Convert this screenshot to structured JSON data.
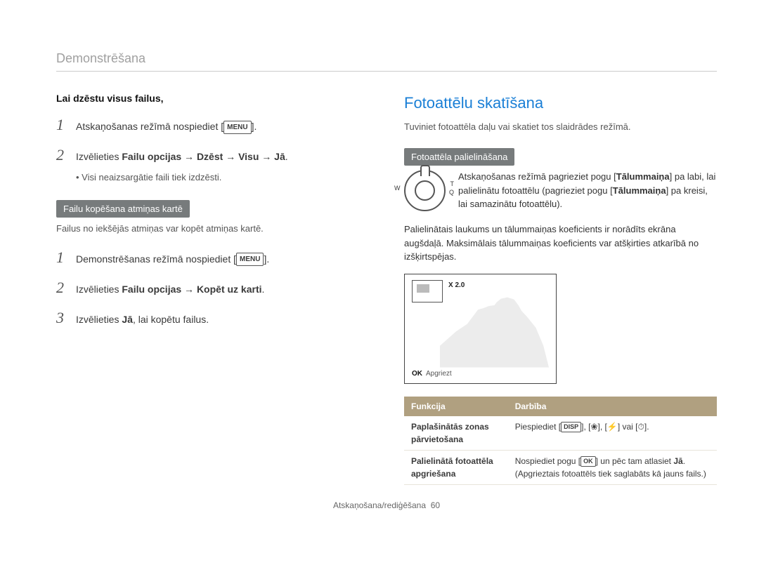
{
  "header": "Demonstrēšana",
  "left": {
    "subhead_delete": "Lai dzēstu visus failus,",
    "step1_a": "Atskaņošanas režīmā nospiediet [",
    "menu_chip": "MENU",
    "step1_b": "].",
    "step2_prefix": "Izvēlieties ",
    "step2_bold": "Failu opcijas → Dzēst → Visu → Jā",
    "step2_suffix": ".",
    "step2_bullet": "Visi neaizsargātie faili tiek izdzēsti.",
    "pill_copy": "Failu kopēšana atmiņas kartē",
    "copy_note": "Failus no iekšējās atmiņas var kopēt atmiņas kartē.",
    "cstep1_a": "Demonstrēšanas režīmā nospiediet [",
    "cstep1_b": "].",
    "cstep2_prefix": "Izvēlieties ",
    "cstep2_bold": "Failu opcijas → Kopēt uz karti",
    "cstep2_suffix": ".",
    "cstep3_prefix": "Izvēlieties ",
    "cstep3_bold": "Jā",
    "cstep3_suffix": ", lai kopētu failus."
  },
  "right": {
    "title": "Fotoattēlu skatīšana",
    "intro": "Tuviniet fotoattēla daļu vai skatiet tos slaidrādes režīmā.",
    "pill_zoom": "Fotoattēla palielināšana",
    "zoom_text_1": "Atskaņošanas režīmā pagrieziet pogu [",
    "zoom_text_bold1": "Tālummaiņa",
    "zoom_text_2": "] pa labi, lai palielinātu fotoattēlu (pagrieziet pogu [",
    "zoom_text_bold2": "Tālummaiņa",
    "zoom_text_3": "] pa kreisi, lai samazinātu fotoattēlu).",
    "dial_w": "W",
    "dial_t": "T",
    "dial_q": "Q",
    "para_limit": "Palielinātais laukums un tālummaiņas koeficients ir norādīts ekrāna augšdaļā. Maksimālais tālummaiņas koeficients var atšķirties atkarībā no izšķirtspējas.",
    "thumb_x": "X 2.0",
    "thumb_ok": "OK",
    "thumb_foot": "Apgriezt",
    "table": {
      "h1": "Funkcija",
      "h2": "Darbība",
      "r1c1": "Paplašinātās zonas pārvietošana",
      "r1c2_a": "Piespiediet [",
      "r1c2_disp": "DISP",
      "r1c2_b": "], [",
      "r1c2_flower": "❀",
      "r1c2_c": "], [",
      "r1c2_flash": "⚡",
      "r1c2_d": "] vai [",
      "r1c2_timer": "⏱",
      "r1c2_e": "].",
      "r2c1": "Palielinātā fotoattēla apgriešana",
      "r2c2_a": "Nospiediet pogu [",
      "r2c2_ok": "OK",
      "r2c2_b": "] un pēc tam atlasiet ",
      "r2c2_bold": "Jā",
      "r2c2_c": ". (Apgrieztais fotoattēls tiek saglabāts kā jauns fails.)"
    }
  },
  "footer": {
    "text": "Atskaņošana/rediģēšana",
    "page": "60"
  }
}
